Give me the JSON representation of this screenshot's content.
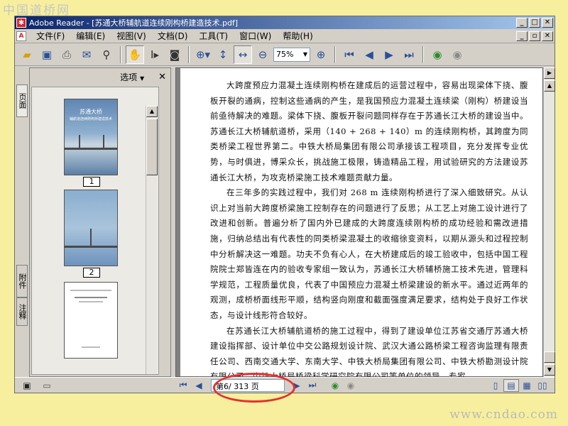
{
  "watermarks": {
    "top": "中国道桥网",
    "bottom": "www.cndao.com"
  },
  "window": {
    "title": "Adobe Reader - [苏通大桥辅航道连续刚构桥建造技术.pdf]",
    "app_icon": "adobe-reader-icon"
  },
  "menu": {
    "items": [
      "文件(F)",
      "编辑(E)",
      "视图(V)",
      "文档(D)",
      "工具(T)",
      "窗口(W)",
      "帮助(H)"
    ]
  },
  "toolbar": {
    "icons": [
      "open-folder-icon",
      "save-icon",
      "print-icon",
      "email-icon",
      "search-icon",
      "hand-tool-icon",
      "select-text-icon",
      "snapshot-icon",
      "zoom-in-icon",
      "fit-page-icon",
      "fit-width-icon",
      "zoom-out-icon",
      "zoom-in-plus-icon",
      "first-page-icon",
      "prev-page-icon",
      "next-page-icon",
      "last-page-icon",
      "go-back-icon",
      "go-forward-icon"
    ],
    "zoom_value": "75%"
  },
  "side_tabs": {
    "pages": "页面",
    "attachments": "附件",
    "comments": "注释"
  },
  "nav_panel": {
    "options_label": "选项",
    "thumbnails": [
      {
        "page": "1",
        "title": "苏通大桥",
        "subtitle": "辅航道连续刚构桥建造技术"
      },
      {
        "page": "2"
      },
      {
        "heading": "苏通大桥辅航道连续刚构桥建造技术"
      }
    ]
  },
  "document": {
    "paragraphs": [
      "大跨度预应力混凝土连续刚构桥在建成后的运营过程中，容易出现梁体下挠、腹板开裂的通病，控制这些通病的产生，是我国预应力混凝土连续梁（刚构）桥建设当前亟待解决的难题。梁体下挠、腹板开裂问题同样存在于苏通长江大桥的建设当中。苏通长江大桥辅航道桥，采用（140 + 268 + 140）m 的连续刚构桥，其跨度为同类桥梁工程世界第二。中铁大桥局集团有限公司承接该工程项目，充分发挥专业优势，与时俱进，博采众长，挑战施工极限，铸造精品工程，用试验研究的方法建设苏通长江大桥，为攻克桥梁施工技术难题贡献力量。",
      "在三年多的实践过程中，我们对 268 m 连续刚构桥进行了深入细致研究。从认识上对当前大跨度桥梁施工控制存在的问题进行了反思；从工艺上对施工设计进行了改进和创新。普遍分析了国内外已建成的大跨度连续刚构桥的成功经验和需改进措施，归纳总结出有代表性的同类桥梁混凝土的收缩徐变资料，以期从源头和过程控制中分析解决这一难题。功夫不负有心人，在大桥建成后的竣工验收中，包括中国工程院院士郑皆连在内的验收专家组一致认为，苏通长江大桥辅桥施工技术先进，管理科学规范，工程质量优良，代表了中国预应力混凝土桥梁建设的新水平。通过近两年的观测，成桥桥面线形平顺，结构竖向刚度和截面强度满足要求，结构处于良好工作状态，与设计线形符合较好。",
      "在苏通长江大桥辅航道桥的施工过程中，得到了建设单位江苏省交通厅苏通大桥建设指挥部、设计单位中交公路规划设计院、武汉大通公路桥梁工程咨询监理有限责任公司、西南交通大学、东南大学、中铁大桥局集团有限公司、中铁大桥勘测设计院有限公司、中铁大桥局桥梁科学研究院有限公司等单位的领导、专家"
    ]
  },
  "statusbar": {
    "page_indicator": "第6/ 313 页"
  }
}
